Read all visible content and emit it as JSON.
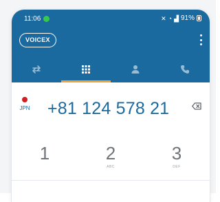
{
  "status_bar": {
    "time": "11:06",
    "battery": "91%"
  },
  "header": {
    "brand": "VOICEX"
  },
  "tabs": [
    {
      "name": "transfer",
      "icon": "swap-arrows-icon",
      "active": false
    },
    {
      "name": "keypad",
      "icon": "dialpad-icon",
      "active": true
    },
    {
      "name": "contacts",
      "icon": "person-icon",
      "active": false
    },
    {
      "name": "calls",
      "icon": "phone-icon",
      "active": false
    }
  ],
  "dialer": {
    "country_code": "JPN",
    "number": "+81 124 578 21"
  },
  "keypad": [
    {
      "digit": "1",
      "letters": ""
    },
    {
      "digit": "2",
      "letters": "ABC"
    },
    {
      "digit": "3",
      "letters": "DEF"
    }
  ],
  "colors": {
    "header": "#1a6aa0",
    "accent": "#f4a23b",
    "status_dot": "#37c94b",
    "flag_red": "#d21f1f"
  }
}
